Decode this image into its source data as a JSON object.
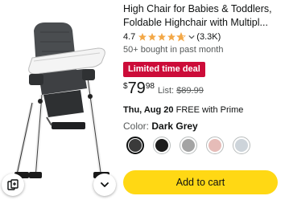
{
  "product": {
    "title_line1": "High Chair for Babies & Toddlers,",
    "title_line2": "Foldable Highchair with Multipl...",
    "rating": "4.7",
    "review_count": "(3.3K)",
    "bought": "50+ bought in past month",
    "deal_badge": "Limited time deal",
    "price_currency": "$",
    "price_whole": "79",
    "price_fraction": "98",
    "list_label": "List:",
    "list_price": "$89.99",
    "delivery_date": "Thu, Aug 20",
    "delivery_text": "FREE with Prime",
    "color_label": "Color:",
    "color_value": "Dark Grey",
    "add_to_cart": "Add to cart"
  },
  "rating_stars": 4.7,
  "swatches": [
    {
      "name": "Dark Grey",
      "color": "#3a3a3a",
      "selected": true
    },
    {
      "name": "black",
      "color": "#1c1c1c",
      "selected": false
    },
    {
      "name": "grey",
      "color": "#a4a4a4",
      "selected": false
    },
    {
      "name": "pink",
      "color": "#e6bcb8",
      "selected": false
    },
    {
      "name": "light grey",
      "color": "#cdd4da",
      "selected": false
    }
  ],
  "colors": {
    "deal_badge": "#cc0c39",
    "cart_button": "#ffd814",
    "star": "#f3a847",
    "muted_text": "#565959"
  },
  "icons": {
    "compare": "compare-icon",
    "expand": "chevron-down-icon"
  }
}
